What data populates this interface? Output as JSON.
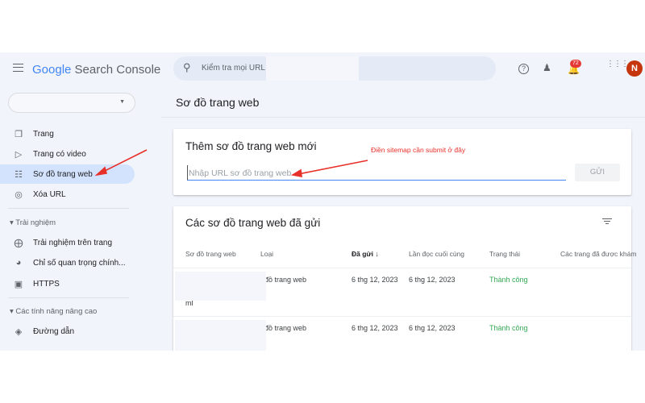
{
  "header": {
    "logo_google": "Google",
    "logo_product": "Search Console",
    "search_placeholder": "Kiểm tra mọi URL",
    "notification_count": "72",
    "avatar_initial": "N"
  },
  "sidebar": {
    "items": [
      {
        "label": "Trang",
        "icon": "pages-icon"
      },
      {
        "label": "Trang có video",
        "icon": "video-icon"
      },
      {
        "label": "Sơ đồ trang web",
        "icon": "sitemap-icon",
        "selected": true
      },
      {
        "label": "Xóa URL",
        "icon": "eye-off-icon"
      }
    ],
    "section1": "Trải nghiệm",
    "section1_items": [
      {
        "label": "Trải nghiệm trên trang",
        "icon": "plus-circle-icon"
      },
      {
        "label": "Chỉ số quan trọng chính...",
        "icon": "gauge-icon"
      },
      {
        "label": "HTTPS",
        "icon": "lock-icon"
      }
    ],
    "section2": "Các tính năng nâng cao",
    "section2_items": [
      {
        "label": "Đường dẫn",
        "icon": "layers-icon"
      }
    ]
  },
  "main": {
    "title": "Sơ đồ trang web",
    "add_card": {
      "title": "Thêm sơ đồ trang web mới",
      "input_placeholder": "Nhập URL sơ đồ trang web",
      "submit_label": "GỬI",
      "annotation": "Điền sitemap cần submit ở đây"
    },
    "list_card": {
      "title": "Các sơ đồ trang web đã gửi",
      "columns": [
        "Sơ đồ trang web",
        "Loại",
        "Đã gửi",
        "Lần đọc cuối cùng",
        "Trạng thái",
        "Các trang đã được khám"
      ],
      "rows": [
        {
          "sitemap": "ml",
          "type": "; đồ trang web",
          "submitted": "6 thg 12, 2023",
          "last_read": "6 thg 12, 2023",
          "status": "Thành công"
        },
        {
          "sitemap": "",
          "type": "; đồ trang web",
          "submitted": "6 thg 12, 2023",
          "last_read": "6 thg 12, 2023",
          "status": "Thành công"
        }
      ]
    }
  },
  "colors": {
    "accent": "#1a73e8",
    "selected": "#d3e3fd",
    "success": "#34a853",
    "annotation": "#e8302a",
    "avatar": "#c5360f"
  }
}
